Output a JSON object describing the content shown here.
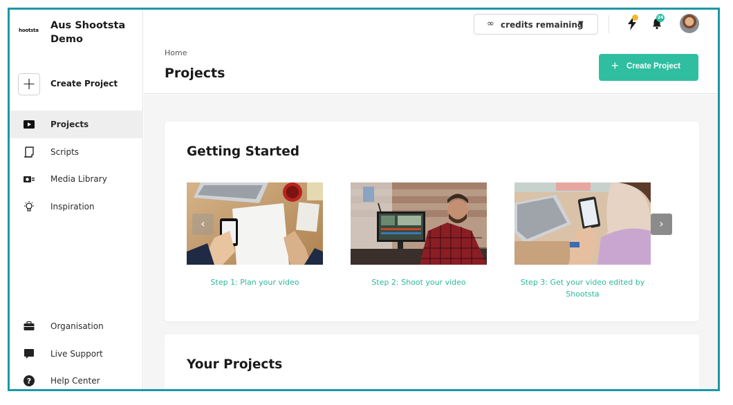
{
  "sidebar": {
    "logo_text": "hootsta",
    "org_name": "Aus Shootsta Demo",
    "create_label": "Create Project",
    "items": [
      {
        "label": "Projects",
        "icon": "play-icon",
        "active": true
      },
      {
        "label": "Scripts",
        "icon": "script-icon",
        "active": false
      },
      {
        "label": "Media Library",
        "icon": "camera-icon",
        "active": false
      },
      {
        "label": "Inspiration",
        "icon": "lightbulb-icon",
        "active": false
      }
    ],
    "bottom_items": [
      {
        "label": "Organisation",
        "icon": "briefcase-icon"
      },
      {
        "label": "Live Support",
        "icon": "chat-icon"
      },
      {
        "label": "Help Center",
        "icon": "help-icon"
      }
    ]
  },
  "topbar": {
    "credits_symbol": "∞",
    "credits_label": "credits remaining",
    "notification_count": "24",
    "colors": {
      "bolt_dot": "#f5b731",
      "badge": "#2dbfa1"
    }
  },
  "header": {
    "breadcrumb": "Home",
    "title": "Projects",
    "create_button": "Create Project"
  },
  "getting_started": {
    "title": "Getting Started",
    "steps": [
      {
        "label": "Step 1: Plan your video"
      },
      {
        "label": "Step 2: Shoot your video"
      },
      {
        "label": "Step 3: Get your video edited by Shootsta"
      }
    ]
  },
  "your_projects": {
    "title": "Your Projects"
  },
  "accent_color": "#2fbfa0"
}
